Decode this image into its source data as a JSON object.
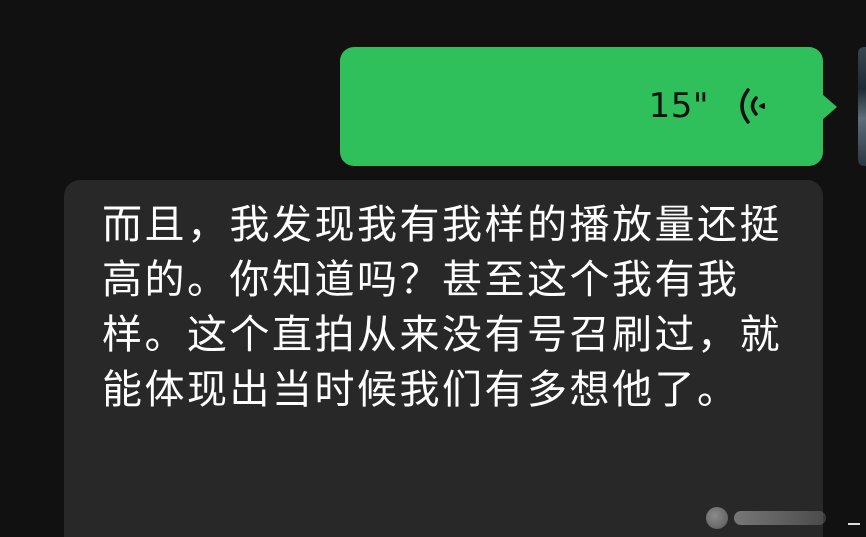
{
  "voice_message": {
    "duration": "15\"",
    "icon": "voice-wave-icon",
    "bubble_color": "#2fbf5b"
  },
  "transcript": {
    "text": "而且，我发现我有我样的播放量还挺高的。你知道吗？甚至这个我有我样。这个直拍从来没有号召刷过，就能体现出当时候我们有多想他了。",
    "bubble_color": "#282828"
  },
  "avatar": {
    "icon": "avatar"
  },
  "colors": {
    "background": "#111111",
    "text": "#ffffff"
  }
}
